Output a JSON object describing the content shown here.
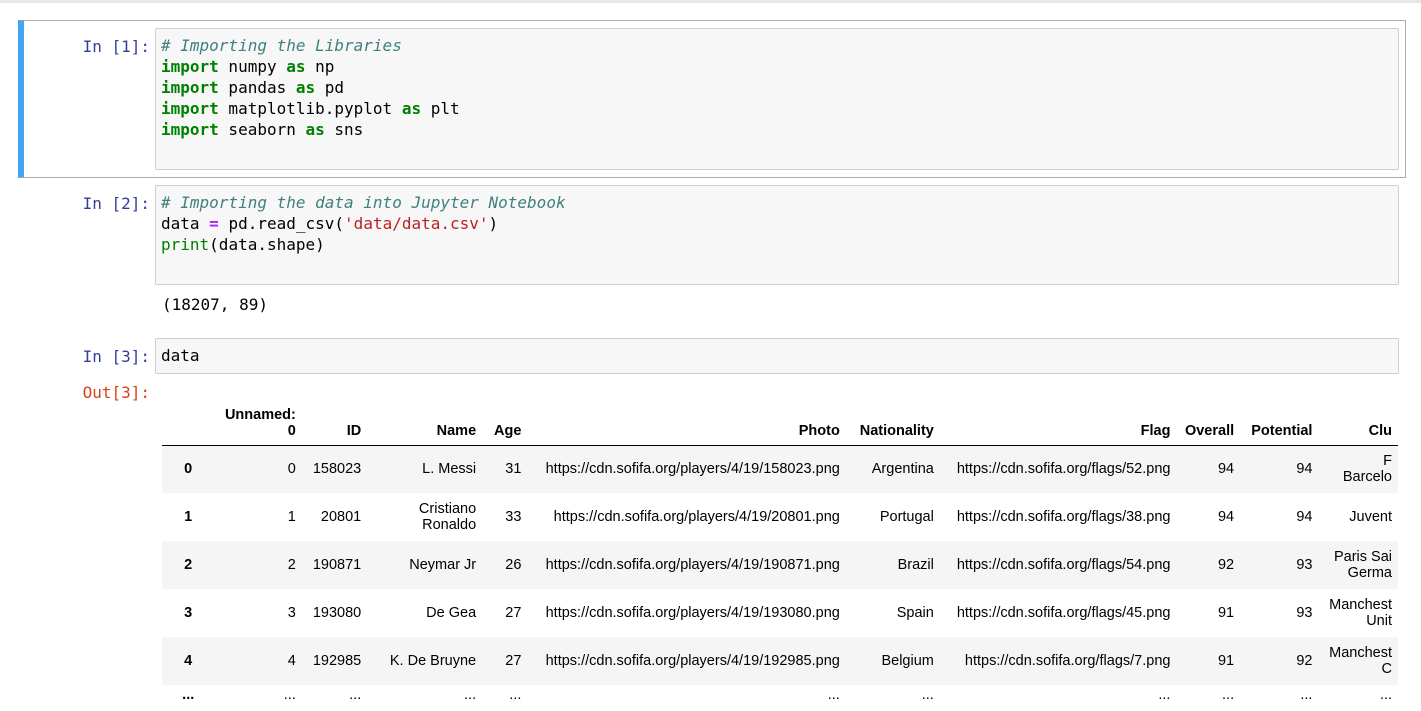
{
  "cells": [
    {
      "prompt": "In [1]:",
      "lines": {
        "l1": "# Importing the Libraries",
        "kw_import": "import",
        "kw_as": "as",
        "l3_mod": " numpy ",
        "l3_alias": " np",
        "l4_mod": " pandas ",
        "l4_alias": " pd",
        "l5_mod": " matplotlib.pyplot ",
        "l5_alias": " plt",
        "l6_mod": " seaborn ",
        "l6_alias": " sns"
      }
    },
    {
      "prompt": "In [2]:",
      "lines": {
        "l1": "# Importing the data into Jupyter Notebook",
        "l3_a": "data ",
        "l3_eq": "=",
        "l3_b": " pd.read_csv(",
        "l3_str": "'data/data.csv'",
        "l3_c": ")",
        "l4_fn": "print",
        "l4_rest": "(data.shape)"
      },
      "stdout": "(18207, 89)"
    },
    {
      "prompt": "In [3]:",
      "code": "data",
      "out_prompt": "Out[3]:"
    }
  ],
  "dataframe": {
    "columns": {
      "unnamed_a": "Unnamed:",
      "unnamed_b": "0",
      "id": "ID",
      "name": "Name",
      "age": "Age",
      "photo": "Photo",
      "nationality": "Nationality",
      "flag": "Flag",
      "overall": "Overall",
      "potential": "Potential",
      "club": "Clu"
    },
    "rows": [
      {
        "idx": "0",
        "unnamed": "0",
        "id": "158023",
        "name_a": "L. Messi",
        "name_b": "",
        "age": "31",
        "photo": "https://cdn.sofifa.org/players/4/19/158023.png",
        "nationality": "Argentina",
        "flag": "https://cdn.sofifa.org/flags/52.png",
        "overall": "94",
        "potential": "94",
        "club_a": "F",
        "club_b": "Barcelo"
      },
      {
        "idx": "1",
        "unnamed": "1",
        "id": "20801",
        "name_a": "Cristiano",
        "name_b": "Ronaldo",
        "age": "33",
        "photo": "https://cdn.sofifa.org/players/4/19/20801.png",
        "nationality": "Portugal",
        "flag": "https://cdn.sofifa.org/flags/38.png",
        "overall": "94",
        "potential": "94",
        "club_a": "Juvent",
        "club_b": ""
      },
      {
        "idx": "2",
        "unnamed": "2",
        "id": "190871",
        "name_a": "Neymar Jr",
        "name_b": "",
        "age": "26",
        "photo": "https://cdn.sofifa.org/players/4/19/190871.png",
        "nationality": "Brazil",
        "flag": "https://cdn.sofifa.org/flags/54.png",
        "overall": "92",
        "potential": "93",
        "club_a": "Paris Sai",
        "club_b": "Germa"
      },
      {
        "idx": "3",
        "unnamed": "3",
        "id": "193080",
        "name_a": "De Gea",
        "name_b": "",
        "age": "27",
        "photo": "https://cdn.sofifa.org/players/4/19/193080.png",
        "nationality": "Spain",
        "flag": "https://cdn.sofifa.org/flags/45.png",
        "overall": "91",
        "potential": "93",
        "club_a": "Manchest",
        "club_b": "Unit"
      },
      {
        "idx": "4",
        "unnamed": "4",
        "id": "192985",
        "name_a": "K. De Bruyne",
        "name_b": "",
        "age": "27",
        "photo": "https://cdn.sofifa.org/players/4/19/192985.png",
        "nationality": "Belgium",
        "flag": "https://cdn.sofifa.org/flags/7.png",
        "overall": "91",
        "potential": "92",
        "club_a": "Manchest",
        "club_b": "C"
      }
    ],
    "ellipsis": "..."
  }
}
